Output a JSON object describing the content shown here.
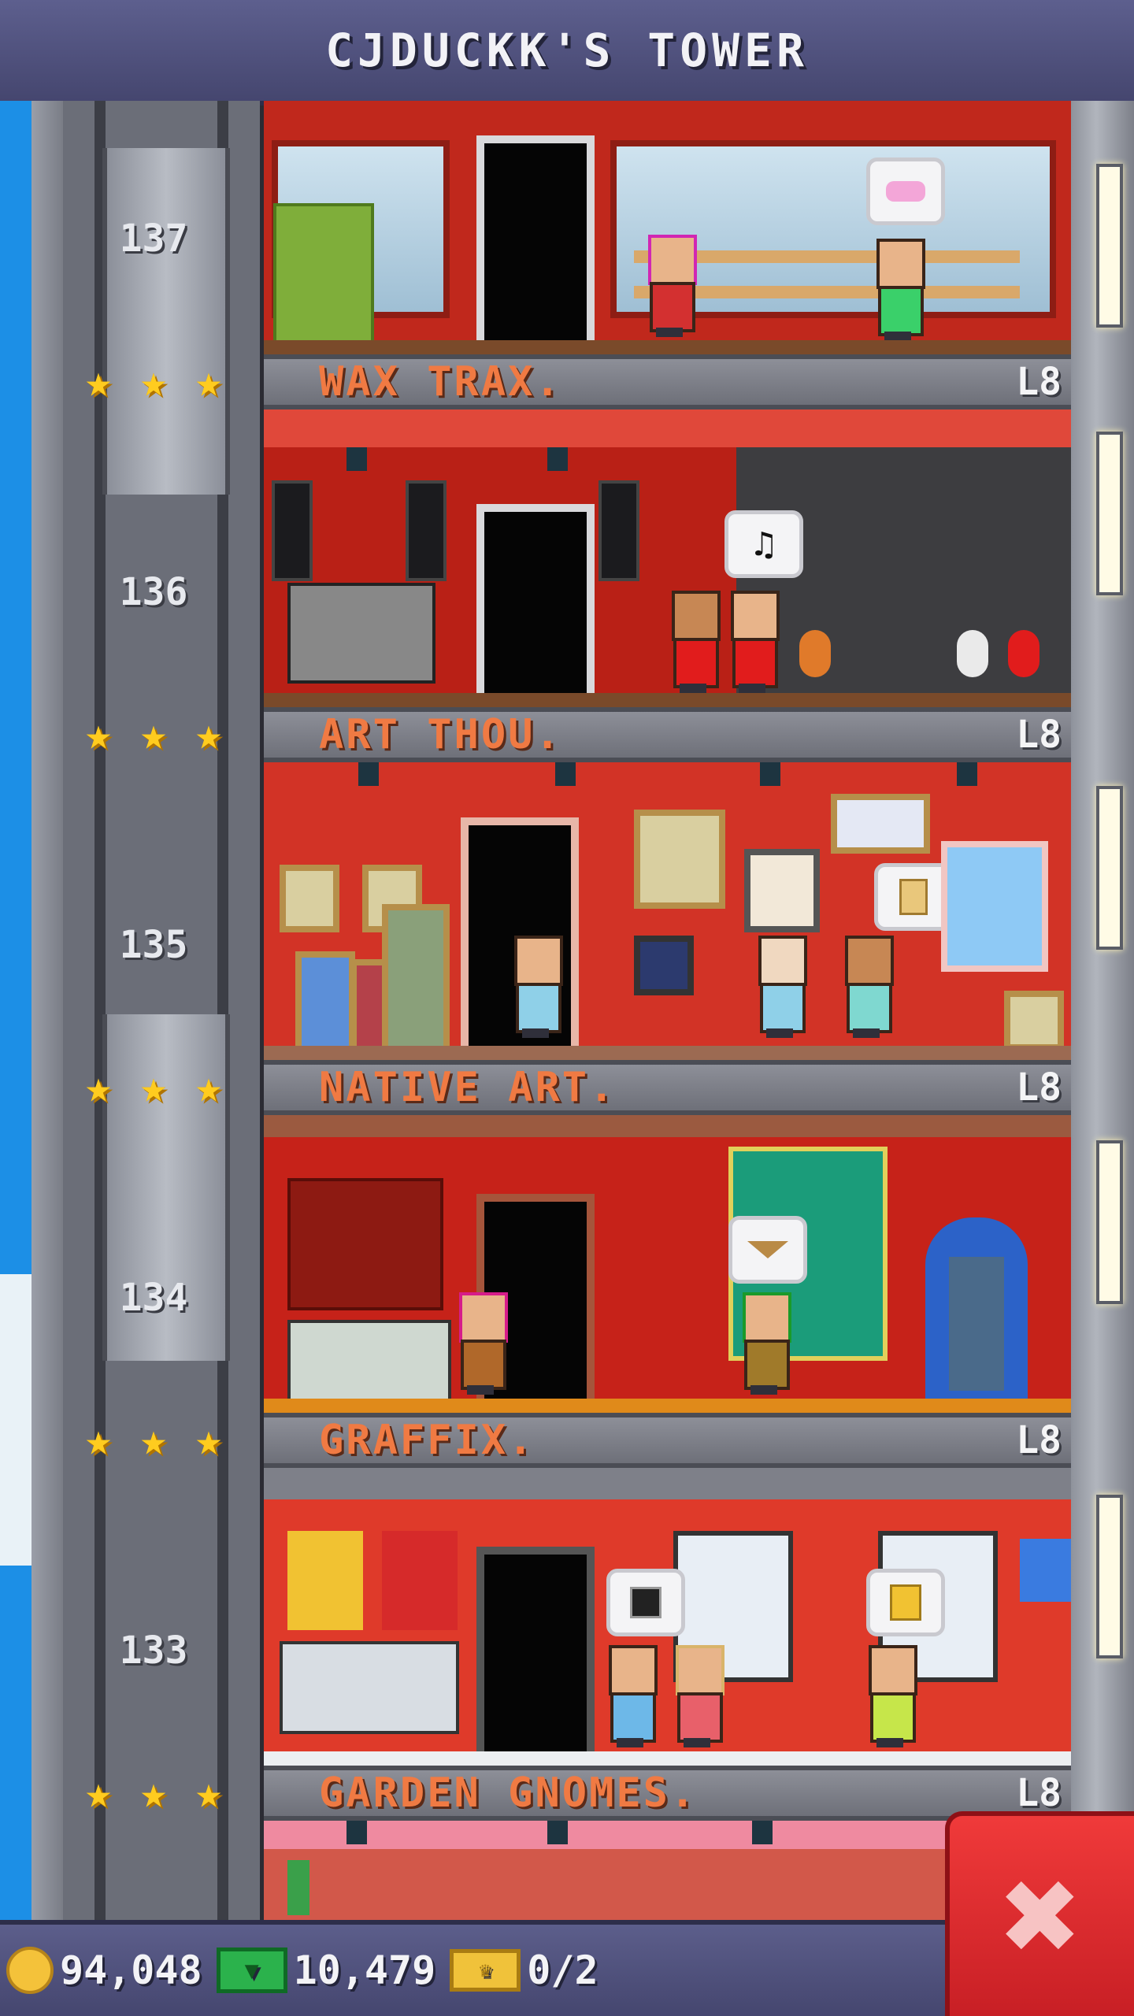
{
  "title": "CJDUCKK'S TOWER",
  "floors": [
    {
      "number": "137",
      "name": "WAX TRAX.",
      "level": "L8"
    },
    {
      "number": "136",
      "name": "ART THOU.",
      "level": "L8"
    },
    {
      "number": "135",
      "name": "NATIVE ART.",
      "level": "L8"
    },
    {
      "number": "134",
      "name": "GRAFFIX.",
      "level": "L8"
    },
    {
      "number": "133",
      "name": "GARDEN GNOMES.",
      "level": "L8"
    }
  ],
  "bubbles": {
    "music_note": "♫"
  },
  "star_glyph": "★",
  "resources": {
    "coins": "94,048",
    "bux": "10,479",
    "vip": "0/2"
  },
  "close_glyph": "✖",
  "colors": {
    "title_bg": "#4f5180",
    "room_red": "#c62a1e",
    "floor_name": "#f07a43",
    "star": "#ffcc1f",
    "close_button": "#e3262c",
    "bux_green": "#2bb24c",
    "coin_gold": "#f4c23a"
  }
}
